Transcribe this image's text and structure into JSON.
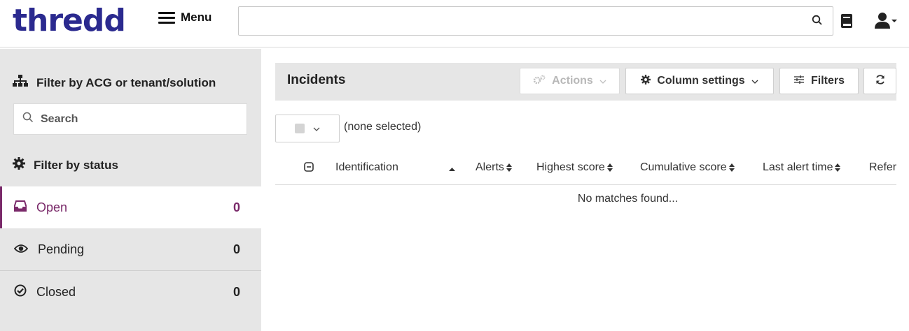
{
  "header": {
    "logo": "thredd",
    "menu_label": "Menu",
    "search_value": ""
  },
  "sidebar": {
    "filter_acg_label": "Filter by ACG or tenant/solution",
    "search_placeholder": "Search",
    "filter_status_label": "Filter by status",
    "statuses": [
      {
        "label": "Open",
        "count": "0",
        "active": true
      },
      {
        "label": "Pending",
        "count": "0",
        "active": false
      },
      {
        "label": "Closed",
        "count": "0",
        "active": false
      }
    ]
  },
  "main": {
    "title": "Incidents",
    "actions_label": "Actions",
    "column_settings_label": "Column settings",
    "filters_label": "Filters",
    "selection_text": "(none selected)",
    "columns": [
      "Identification",
      "Alerts",
      "Highest score",
      "Cumulative score",
      "Last alert time",
      "Refer"
    ],
    "empty_text": "No matches found..."
  },
  "colors": {
    "brand": "#2b2a8f",
    "accent": "#7a2a6a",
    "panel_bg": "#e6e6e6"
  }
}
